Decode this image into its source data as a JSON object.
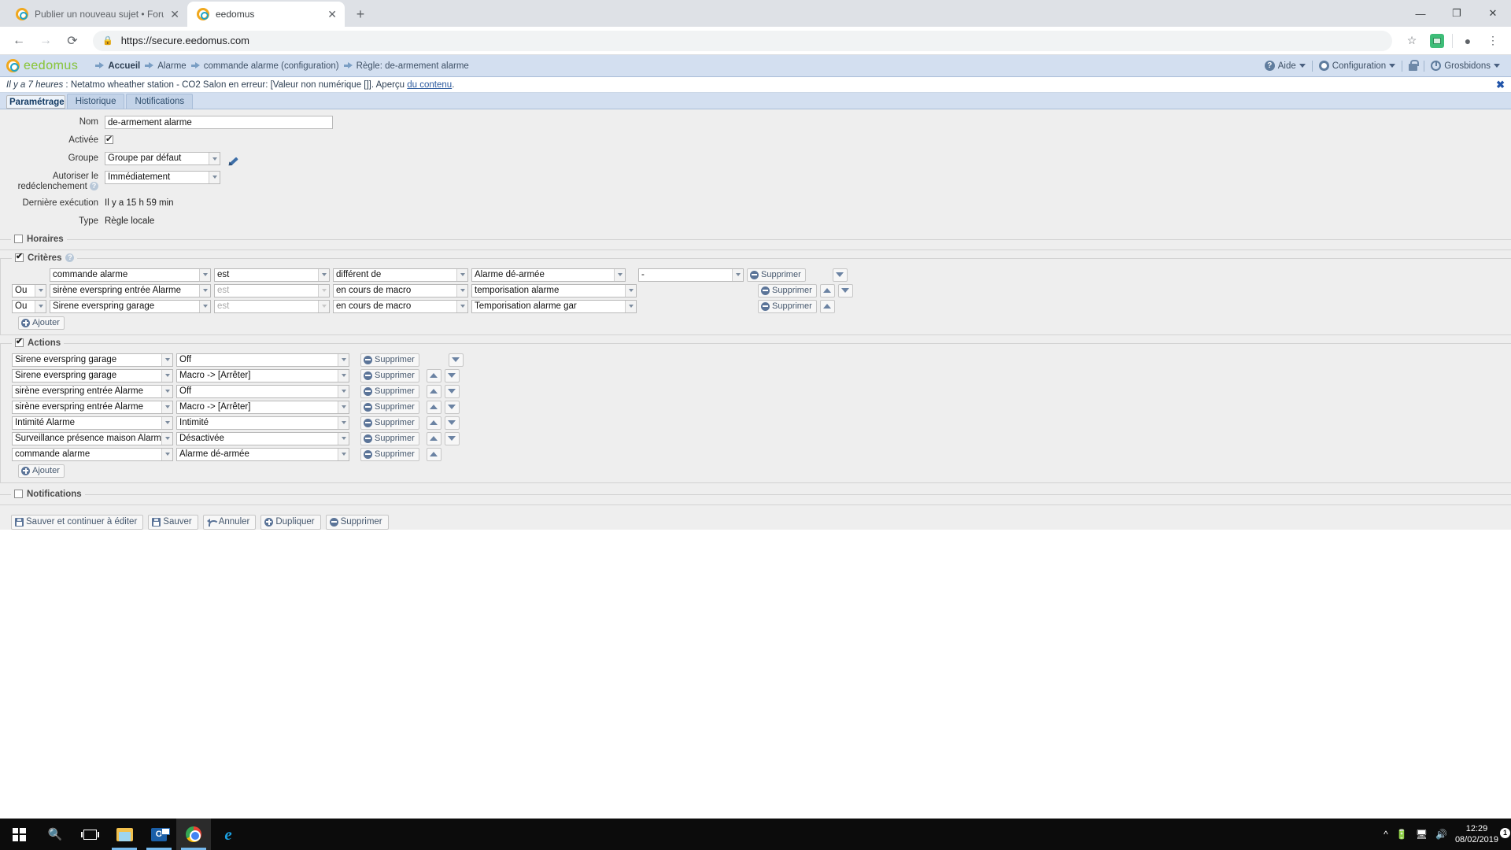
{
  "browser": {
    "tabs": [
      {
        "title": "Publier un nouveau sujet • Forum",
        "favicon": "forum-favicon",
        "active": false
      },
      {
        "title": "eedomus",
        "favicon": "eedomus-favicon",
        "active": true
      }
    ],
    "new_tab_label": "+",
    "window_controls": {
      "minimize": "—",
      "maximize": "❐",
      "close": "✕"
    },
    "nav": {
      "back": "←",
      "forward": "→",
      "reload": "⟳"
    },
    "address": {
      "url": "https://secure.eedomus.com",
      "lock": "lock-icon"
    },
    "toolbar_icons": {
      "bookmark": "☆",
      "extension": "extension-icon",
      "profile": "●",
      "menu": "⋮"
    }
  },
  "app": {
    "logo_text": "eedomus",
    "breadcrumbs": [
      {
        "label": "Accueil",
        "bold": true
      },
      {
        "label": "Alarme",
        "bold": false
      },
      {
        "label": "commande alarme (configuration)",
        "bold": false
      },
      {
        "label": "Règle: de-armement alarme",
        "bold": false
      }
    ],
    "header_right": [
      {
        "label": "Aide",
        "icon": "help-icon",
        "caret": true
      },
      {
        "label": "Configuration",
        "icon": "gear-icon",
        "caret": true
      },
      {
        "label": "",
        "icon": "lock-icon",
        "caret": false
      },
      {
        "label": "Grosbidons",
        "icon": "power-icon",
        "caret": true
      }
    ]
  },
  "alert": {
    "time_prefix": "Il y a 7 heures",
    "separator": " : ",
    "message": "Netatmo wheather station - CO2 Salon en erreur: [Valeur non numérique []]. Aperçu ",
    "link": "du contenu",
    "tail": ".",
    "close": "✖"
  },
  "page_tabs": [
    {
      "label": "Paramétrage",
      "selected": true
    },
    {
      "label": "Historique",
      "selected": false
    },
    {
      "label": "Notifications",
      "selected": false
    }
  ],
  "form": {
    "nom": {
      "label": "Nom",
      "value": "de-armement alarme"
    },
    "activee": {
      "label": "Activée",
      "checked": true
    },
    "groupe": {
      "label": "Groupe",
      "value": "Groupe par défaut",
      "edit_icon": "pencil-icon"
    },
    "redeclenchement": {
      "label_line1": "Autoriser le",
      "label_line2": "redéclenchement",
      "value": "Immédiatement",
      "help_icon": "question-icon"
    },
    "derniere_execution": {
      "label": "Dernière exécution",
      "value": "Il y a 15 h 59 min"
    },
    "type": {
      "label": "Type",
      "value": "Règle locale"
    }
  },
  "sections": {
    "horaires": {
      "label": "Horaires",
      "checked": false
    },
    "criteres": {
      "label": "Critères",
      "checked": true,
      "help_icon": "question-icon"
    },
    "actions": {
      "label": "Actions",
      "checked": true
    },
    "notifications": {
      "label": "Notifications",
      "checked": false
    }
  },
  "criteria": {
    "add_label": "Ajouter",
    "delete_label": "Supprimer",
    "rows": [
      {
        "conj": null,
        "device": "commande alarme",
        "verb": "est",
        "verb_disabled": false,
        "operator": "différent de",
        "value": "Alarme dé-armée",
        "extra": "-",
        "has_extra": true,
        "up": false,
        "down": true
      },
      {
        "conj": "Ou",
        "device": "sirène everspring entrée Alarme",
        "verb": "est",
        "verb_disabled": true,
        "operator": "en cours de macro",
        "value": "temporisation alarme",
        "extra": null,
        "has_extra": false,
        "up": true,
        "down": true
      },
      {
        "conj": "Ou",
        "device": "Sirene everspring garage",
        "verb": "est",
        "verb_disabled": true,
        "operator": "en cours de macro",
        "value": "Temporisation alarme gar",
        "extra": null,
        "has_extra": false,
        "up": true,
        "down": false
      }
    ]
  },
  "actions": {
    "add_label": "Ajouter",
    "delete_label": "Supprimer",
    "rows": [
      {
        "device": "Sirene everspring garage",
        "value": "Off",
        "up": false,
        "down": true
      },
      {
        "device": "Sirene everspring garage",
        "value": "Macro -> [Arrêter]",
        "up": true,
        "down": true
      },
      {
        "device": "sirène everspring entrée Alarme",
        "value": "Off",
        "up": true,
        "down": true
      },
      {
        "device": "sirène everspring entrée Alarme",
        "value": "Macro -> [Arrêter]",
        "up": true,
        "down": true
      },
      {
        "device": "Intimité Alarme",
        "value": "Intimité",
        "up": true,
        "down": true
      },
      {
        "device": "Surveillance présence maison Alarm",
        "value": "Désactivée",
        "up": true,
        "down": true
      },
      {
        "device": "commande alarme",
        "value": "Alarme dé-armée",
        "up": true,
        "down": false
      }
    ]
  },
  "footer_buttons": [
    {
      "label": "Sauver et continuer à éditer",
      "icon": "save-icon"
    },
    {
      "label": "Sauver",
      "icon": "save-icon"
    },
    {
      "label": "Annuler",
      "icon": "undo-icon"
    },
    {
      "label": "Dupliquer",
      "icon": "plus-circle-icon"
    },
    {
      "label": "Supprimer",
      "icon": "minus-circle-icon"
    }
  ],
  "taskbar": {
    "items": [
      {
        "name": "start-button",
        "icon": "windows-logo-icon"
      },
      {
        "name": "search-button",
        "icon": "search-icon"
      },
      {
        "name": "task-view-button",
        "icon": "task-view-icon"
      },
      {
        "name": "file-explorer-button",
        "icon": "folder-icon"
      },
      {
        "name": "outlook-button",
        "icon": "outlook-icon"
      },
      {
        "name": "chrome-button",
        "icon": "chrome-icon"
      },
      {
        "name": "internet-explorer-button",
        "icon": "ie-icon"
      }
    ],
    "clock": {
      "time": "12:29",
      "date": "08/02/2019"
    },
    "notification_count": "1"
  },
  "colors": {
    "header_bg": "#d3dff0",
    "accent_green": "#8dc63f",
    "accent_orange": "#f0a81e",
    "accent_blue": "#1fa3c6",
    "button_icon": "#5b7498",
    "tab_selected": "#eef4fb"
  }
}
